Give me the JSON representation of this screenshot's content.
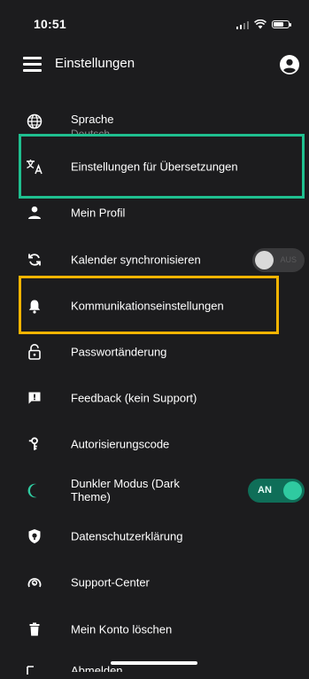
{
  "status": {
    "time": "10:51"
  },
  "appbar": {
    "title": "Einstellungen"
  },
  "menu": {
    "language": {
      "label": "Sprache",
      "value": "Deutsch"
    },
    "translation_settings": {
      "label": "Einstellungen für Übersetzungen"
    },
    "profile": {
      "label": "Mein Profil"
    },
    "calendar_sync": {
      "label": "Kalender synchronisieren",
      "toggle_text": "AUS",
      "enabled": false
    },
    "communication": {
      "label": "Kommunikationseinstellungen"
    },
    "password": {
      "label": "Passwortänderung"
    },
    "feedback": {
      "label": "Feedback (kein Support)"
    },
    "auth_code": {
      "label": "Autorisierungscode"
    },
    "dark_mode": {
      "label": "Dunkler Modus (Dark Theme)",
      "toggle_text": "AN",
      "enabled": true
    },
    "privacy": {
      "label": "Datenschutzerklärung"
    },
    "support": {
      "label": "Support-Center"
    },
    "delete_account": {
      "label": "Mein Konto löschen"
    },
    "logout": {
      "label": "Abmelden"
    }
  },
  "colors": {
    "background": "#1c1c1e",
    "accent": "#2fcaa0",
    "highlight_green": "#1fbf8f",
    "highlight_yellow": "#f5b400"
  }
}
